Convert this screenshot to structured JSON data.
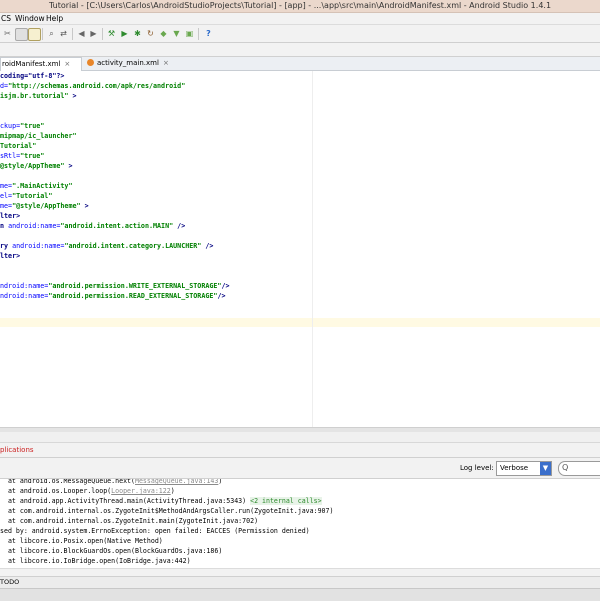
{
  "window": {
    "title": "Tutorial - [C:\\Users\\Carlos\\AndroidStudioProjects\\Tutorial] - [app] - ...\\app\\src\\main\\AndroidManifest.xml - Android Studio 1.4.1"
  },
  "menu": {
    "items": [
      "CS",
      "Window",
      "Help"
    ]
  },
  "tabs": [
    {
      "label": "roidManifest.xml",
      "close": "×"
    },
    {
      "label": "activity_main.xml",
      "close": "×"
    }
  ],
  "editor": {
    "lines": [
      {
        "parts": [
          [
            "t",
            "coding=\"utf-8\"?>"
          ]
        ]
      },
      {
        "parts": [
          [
            "a",
            "d="
          ],
          [
            "v",
            "\"http://schemas.android.com/apk/res/android\""
          ]
        ]
      },
      {
        "parts": [
          [
            "v",
            "isjm.br.tutorial\""
          ],
          [
            "t",
            " >"
          ]
        ]
      },
      {
        "parts": [
          [
            "t",
            ""
          ]
        ]
      },
      {
        "parts": [
          [
            "t",
            ""
          ]
        ]
      },
      {
        "parts": [
          [
            "a",
            "ckup="
          ],
          [
            "v",
            "\"true\""
          ]
        ]
      },
      {
        "parts": [
          [
            "v",
            "mipmap/ic_launcher\""
          ]
        ]
      },
      {
        "parts": [
          [
            "v",
            "Tutorial\""
          ]
        ]
      },
      {
        "parts": [
          [
            "a",
            "sRtl="
          ],
          [
            "v",
            "\"true\""
          ]
        ]
      },
      {
        "parts": [
          [
            "v",
            "@style/AppTheme\""
          ],
          [
            "t",
            " >"
          ]
        ]
      },
      {
        "parts": [
          [
            "t",
            ""
          ]
        ]
      },
      {
        "parts": [
          [
            "a",
            "me="
          ],
          [
            "v",
            "\".MainActivity\""
          ]
        ]
      },
      {
        "parts": [
          [
            "a",
            "el="
          ],
          [
            "v",
            "\"Tutorial\""
          ]
        ]
      },
      {
        "parts": [
          [
            "a",
            "me="
          ],
          [
            "v",
            "\"@style/AppTheme\""
          ],
          [
            "t",
            " >"
          ]
        ]
      },
      {
        "parts": [
          [
            "t",
            "lter>"
          ]
        ]
      },
      {
        "parts": [
          [
            "t",
            "n "
          ],
          [
            "a",
            "android:name="
          ],
          [
            "v",
            "\"android.intent.action.MAIN\""
          ],
          [
            "t",
            " />"
          ]
        ]
      },
      {
        "parts": [
          [
            "t",
            ""
          ]
        ]
      },
      {
        "parts": [
          [
            "t",
            "ry "
          ],
          [
            "a",
            "android:name="
          ],
          [
            "v",
            "\"android.intent.category.LAUNCHER\""
          ],
          [
            "t",
            " />"
          ]
        ]
      },
      {
        "parts": [
          [
            "t",
            "lter>"
          ]
        ]
      },
      {
        "parts": [
          [
            "t",
            ""
          ]
        ]
      },
      {
        "parts": [
          [
            "t",
            ""
          ]
        ]
      },
      {
        "parts": [
          [
            "a",
            "ndroid:name="
          ],
          [
            "v",
            "\"android.permission.WRITE_EXTERNAL_STORAGE\""
          ],
          [
            "t",
            "/>"
          ]
        ]
      },
      {
        "parts": [
          [
            "a",
            "ndroid:name="
          ],
          [
            "v",
            "\"android.permission.READ_EXTERNAL_STORAGE\""
          ],
          [
            "t",
            "/>"
          ]
        ]
      }
    ]
  },
  "logcat": {
    "filter_label": "plications",
    "log_level_label": "Log level:",
    "log_level_value": "Verbose",
    "search_placeholder": "Q",
    "lines": [
      [
        [
          "n",
          "  at android.os.MessageQueue.next("
        ],
        [
          "l",
          "MessageQueue.java:143"
        ],
        [
          "n",
          ")"
        ]
      ],
      [
        [
          "n",
          "  at android.os.Looper.loop("
        ],
        [
          "l",
          "Looper.java:122"
        ],
        [
          "n",
          ")"
        ]
      ],
      [
        [
          "n",
          "  at android.app.ActivityThread.main(ActivityThread.java:5343) "
        ],
        [
          "c",
          "<2 internal calls>"
        ]
      ],
      [
        [
          "n",
          "  at com.android.internal.os.ZygoteInit$MethodAndArgsCaller.run(ZygoteInit.java:907)"
        ]
      ],
      [
        [
          "n",
          "  at com.android.internal.os.ZygoteInit.main(ZygoteInit.java:702)"
        ]
      ],
      [
        [
          "n",
          "sed by: android.system.ErrnoException: open failed: EACCES (Permission denied)"
        ]
      ],
      [
        [
          "n",
          "  at libcore.io.Posix.open(Native Method)"
        ]
      ],
      [
        [
          "n",
          "  at libcore.io.BlockGuardOs.open(BlockGuardOs.java:186)"
        ]
      ],
      [
        [
          "n",
          "  at libcore.io.IoBridge.open(IoBridge.java:442)"
        ]
      ]
    ]
  },
  "bottom_tool": {
    "label": "TODO"
  },
  "colors": {
    "accent": "#3b6fcb",
    "current_line": "#fffae3",
    "error": "#cc2222"
  }
}
